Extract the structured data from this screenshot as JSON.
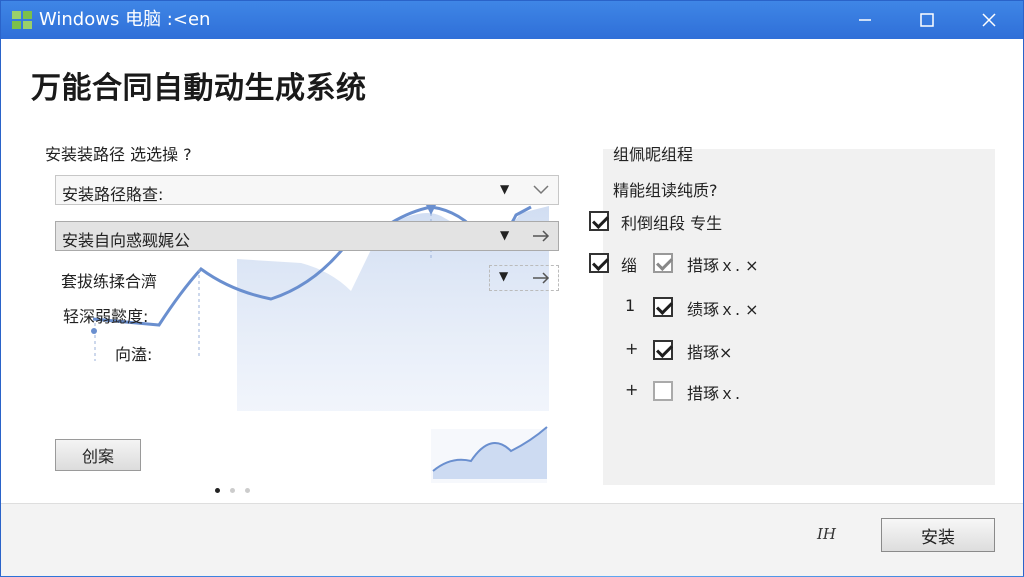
{
  "window": {
    "title": "Windows 电脑 :<en",
    "accent": "#2f6fd8"
  },
  "page": {
    "title": "万能合同自動动生成系统"
  },
  "left": {
    "path_label": "安装装路径 选选操 ?",
    "combos": [
      {
        "value": "安装路径賂查: "
      },
      {
        "value": "安装自向惑觋娓公"
      },
      {
        "value": "套拔练揉合濟"
      }
    ],
    "progress_label": "轻深弱懿度:",
    "direction_label": "向溘:",
    "create_button": "创案"
  },
  "right": {
    "title": "组佩昵组程",
    "subtitle": "精能组读纯质?",
    "options": [
      {
        "text": "利倒组段 专生",
        "checked": true
      },
      {
        "text": "缁",
        "checked": true
      },
      {
        "text": "措琢ｘ. ×",
        "checked": true
      },
      {
        "text": "绩琢ｘ. ×",
        "checked": true
      },
      {
        "text": "揩琢×",
        "checked": true
      },
      {
        "text": "措琢ｘ.",
        "checked": false
      }
    ],
    "bullets": [
      "1",
      "+",
      "+"
    ]
  },
  "footer": {
    "text": "IH",
    "install_button": "安装"
  }
}
